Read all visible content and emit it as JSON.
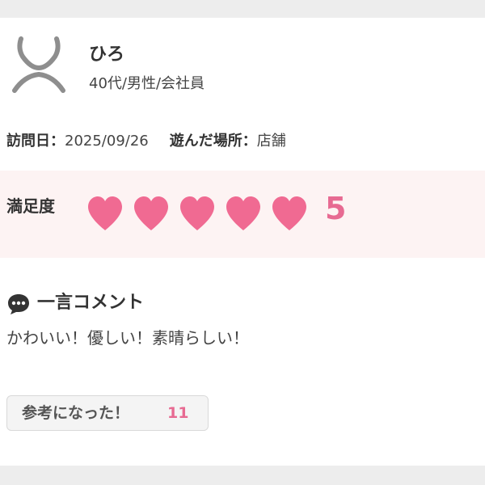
{
  "review": {
    "user": {
      "name": "ひろ",
      "profile": "40代/男性/会社員",
      "avatar_icon": "user-silhouette-icon"
    },
    "visit": {
      "date_label": "訪問日：",
      "date": "2025/09/26",
      "place_label": "遊んだ場所：",
      "place": "店舗"
    },
    "rating": {
      "label": "満足度",
      "value": "5",
      "max": 5,
      "heart_icon": "heart-icon",
      "heart_color": "#f06a92"
    },
    "comment": {
      "icon": "speech-bubble-icon",
      "title": "一言コメント",
      "text": "かわいい！優しい！素晴らしい！"
    },
    "helpful": {
      "label": "参考になった！",
      "count": "11"
    }
  },
  "colors": {
    "accent": "#e76a92",
    "rating_band_bg": "#fdf3f3",
    "page_bg": "#ededed"
  }
}
